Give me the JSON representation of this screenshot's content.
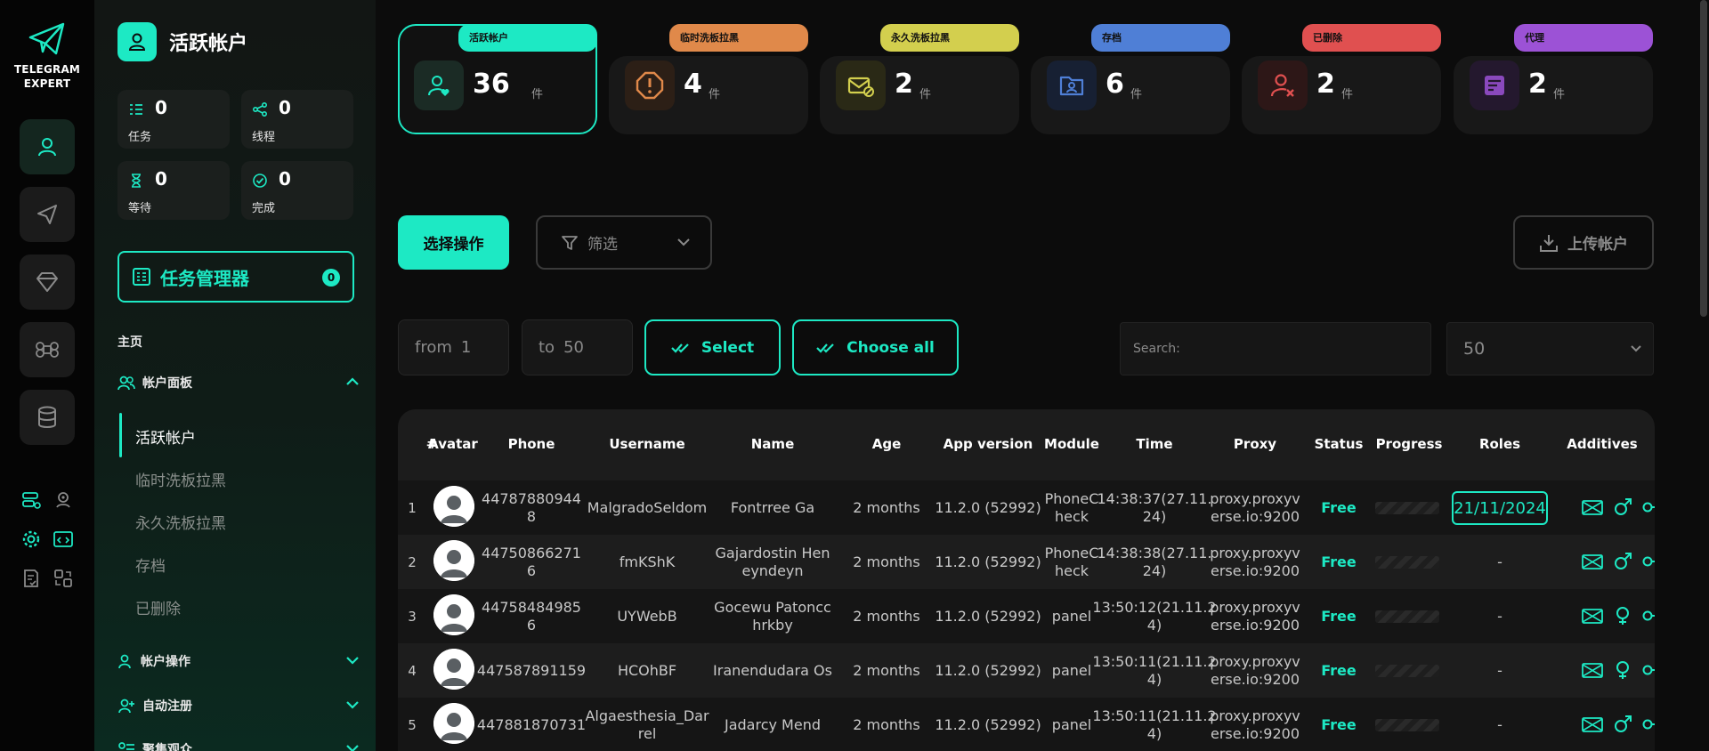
{
  "brand": {
    "line1": "TELEGRAM",
    "line2": "EXPERT"
  },
  "sidebar": {
    "title": "活跃帐户",
    "stats": [
      {
        "icon": "task-list-icon",
        "value": "0",
        "label": "任务"
      },
      {
        "icon": "thread-icon",
        "value": "0",
        "label": "线程"
      },
      {
        "icon": "hourglass-icon",
        "value": "0",
        "label": "等待"
      },
      {
        "icon": "check-circle-icon",
        "value": "0",
        "label": "完成"
      }
    ],
    "task_manager": {
      "label": "任务管理器",
      "badge": "0"
    },
    "section_title": "主页",
    "groups": {
      "accounts_panel": "帐户面板",
      "account_ops": "帐户操作",
      "auto_register": "自动注册",
      "cut_off": "聚集观众"
    },
    "sub_items": [
      "活跃帐户",
      "临时洗板拉黑",
      "永久洗板拉黑",
      "存档",
      "已删除"
    ]
  },
  "cards": [
    {
      "tab": "活跃帐户",
      "value": "36",
      "unit": "件",
      "color": "#1de9c4",
      "icon": "user-heart-icon"
    },
    {
      "tab": "临时洗板拉黑",
      "value": "4",
      "unit": "件",
      "color": "#e0894a",
      "icon": "alert-icon"
    },
    {
      "tab": "永久洗板拉黑",
      "value": "2",
      "unit": "件",
      "color": "#d3cf4e",
      "icon": "mail-block-icon"
    },
    {
      "tab": "存档",
      "value": "6",
      "unit": "件",
      "color": "#4f7fd6",
      "icon": "folder-user-icon"
    },
    {
      "tab": "已删除",
      "value": "2",
      "unit": "件",
      "color": "#e05050",
      "icon": "user-x-icon"
    },
    {
      "tab": "代理",
      "value": "2",
      "unit": "件",
      "color": "#9c52d6",
      "icon": "proxy-icon"
    }
  ],
  "toolbar": {
    "select_op": "选择操作",
    "filter": "筛选",
    "upload": "上传帐户",
    "from_label": "from",
    "from_value": "1",
    "to_label": "to",
    "to_value": "50",
    "select_btn": "Select",
    "choose_all_btn": "Choose all",
    "search_placeholder": "Search:",
    "page_size": "50"
  },
  "table": {
    "headers": [
      "#",
      "Avatar",
      "Phone",
      "Username",
      "Name",
      "Age",
      "App version",
      "Module",
      "Time",
      "Proxy",
      "Status",
      "Progress",
      "Roles",
      "Additives"
    ],
    "rows": [
      {
        "n": "1",
        "phone_1": "44787880944",
        "phone_2": "8",
        "username": "MalgradoSeldom",
        "name_1": "Fontrree Ga",
        "name_2": "",
        "age": "2 months",
        "app": "11.2.0 (52992)",
        "module_1": "PhoneC",
        "module_2": "heck",
        "time_1": "14:38:37(27.11.",
        "time_2": "24)",
        "proxy_1": "proxy.proxyv",
        "proxy_2": "erse.io:9200",
        "status": "Free",
        "role": "21/11/2024",
        "gender": "male"
      },
      {
        "n": "2",
        "phone_1": "44750866271",
        "phone_2": "6",
        "username": "fmKShK",
        "name_1": "Gajardostin Hen",
        "name_2": "eyndeyn",
        "age": "2 months",
        "app": "11.2.0 (52992)",
        "module_1": "PhoneC",
        "module_2": "heck",
        "time_1": "14:38:38(27.11.",
        "time_2": "24)",
        "proxy_1": "proxy.proxyv",
        "proxy_2": "erse.io:9200",
        "status": "Free",
        "role": "-",
        "gender": "male"
      },
      {
        "n": "3",
        "phone_1": "44758484985",
        "phone_2": "6",
        "username": "UYWebB",
        "name_1": "Gocewu Patoncc",
        "name_2": "hrkby",
        "age": "2 months",
        "app": "11.2.0 (52992)",
        "module_1": "panel",
        "module_2": "",
        "time_1": "13:50:12(21.11.2",
        "time_2": "4)",
        "proxy_1": "proxy.proxyv",
        "proxy_2": "erse.io:9200",
        "status": "Free",
        "role": "-",
        "gender": "female"
      },
      {
        "n": "4",
        "phone_1": "447587891159",
        "phone_2": "",
        "username": "HCOhBF",
        "name_1": "Iranendudara Os",
        "name_2": "",
        "age": "2 months",
        "app": "11.2.0 (52992)",
        "module_1": "panel",
        "module_2": "",
        "time_1": "13:50:11(21.11.2",
        "time_2": "4)",
        "proxy_1": "proxy.proxyv",
        "proxy_2": "erse.io:9200",
        "status": "Free",
        "role": "-",
        "gender": "female"
      },
      {
        "n": "5",
        "phone_1": "447881870731",
        "phone_2": "",
        "username": "Algaesthesia_Dar",
        "username_2": "rel",
        "name_1": "Jadarcy Mend",
        "name_2": "",
        "age": "2 months",
        "app": "11.2.0 (52992)",
        "module_1": "panel",
        "module_2": "",
        "time_1": "13:50:11(21.11.2",
        "time_2": "4)",
        "proxy_1": "proxy.proxyv",
        "proxy_2": "erse.io:9200",
        "status": "Free",
        "role": "-",
        "gender": "male"
      }
    ]
  }
}
